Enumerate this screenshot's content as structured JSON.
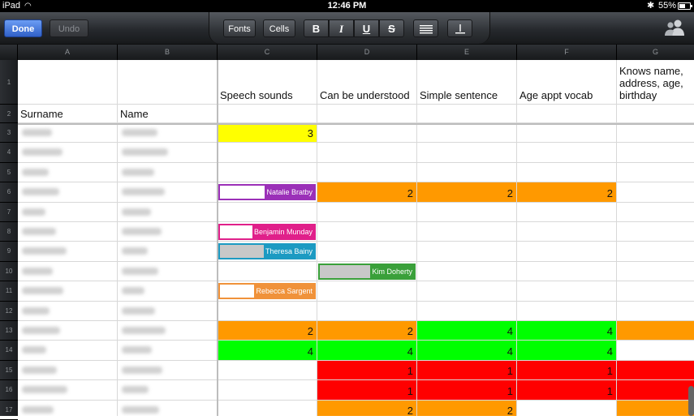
{
  "status_bar": {
    "device": "iPad",
    "time": "12:46 PM",
    "battery": "55%"
  },
  "toolbar": {
    "done_label": "Done",
    "undo_label": "Undo",
    "fonts_label": "Fonts",
    "cells_label": "Cells",
    "bold_label": "B",
    "italic_label": "I",
    "underline_label": "U",
    "strike_label": "S"
  },
  "columns": [
    "A",
    "B",
    "C",
    "D",
    "E",
    "F",
    "G"
  ],
  "rows": [
    "1",
    "2",
    "3",
    "4",
    "5",
    "6",
    "7",
    "8",
    "9",
    "10",
    "11",
    "12",
    "13",
    "14",
    "15",
    "16",
    "17"
  ],
  "headers": {
    "surname": "Surname",
    "name": "Name",
    "c": "Speech sounds",
    "d": "Can be understood",
    "e": "Simple sentence",
    "f": "Age appt vocab",
    "g": "Knows name, address, age, birthday"
  },
  "colors": {
    "yellow": "#ffff00",
    "orange": "#ff9900",
    "green": "#00ff00",
    "red": "#ff0000",
    "accent_blue": "#3060c8"
  },
  "comments": [
    {
      "row": 6,
      "col": "C",
      "author": "Natalie Bratby",
      "color": "#9b30b8"
    },
    {
      "row": 8,
      "col": "C",
      "author": "Benjamin Munday",
      "color": "#e0208a"
    },
    {
      "row": 9,
      "col": "C",
      "author": "Theresa Bainy",
      "color": "#1c9ac2"
    },
    {
      "row": 10,
      "col": "D",
      "author": "Kim Doherty",
      "color": "#3aa03a"
    },
    {
      "row": 11,
      "col": "C",
      "author": "Rebecca Sargent",
      "color": "#f0923a"
    }
  ],
  "cells": [
    {
      "row": 3,
      "col": "C",
      "value": "3",
      "fill": "#ffff00"
    },
    {
      "row": 6,
      "col": "D",
      "value": "2",
      "fill": "#ff9900"
    },
    {
      "row": 6,
      "col": "E",
      "value": "2",
      "fill": "#ff9900"
    },
    {
      "row": 6,
      "col": "F",
      "value": "2",
      "fill": "#ff9900"
    },
    {
      "row": 13,
      "col": "C",
      "value": "2",
      "fill": "#ff9900"
    },
    {
      "row": 13,
      "col": "D",
      "value": "2",
      "fill": "#ff9900"
    },
    {
      "row": 13,
      "col": "E",
      "value": "4",
      "fill": "#00ff00"
    },
    {
      "row": 13,
      "col": "F",
      "value": "4",
      "fill": "#00ff00"
    },
    {
      "row": 13,
      "col": "G",
      "value": "",
      "fill": "#ff9900"
    },
    {
      "row": 14,
      "col": "C",
      "value": "4",
      "fill": "#00ff00"
    },
    {
      "row": 14,
      "col": "D",
      "value": "4",
      "fill": "#00ff00"
    },
    {
      "row": 14,
      "col": "E",
      "value": "4",
      "fill": "#00ff00"
    },
    {
      "row": 14,
      "col": "F",
      "value": "4",
      "fill": "#00ff00"
    },
    {
      "row": 15,
      "col": "D",
      "value": "1",
      "fill": "#ff0000"
    },
    {
      "row": 15,
      "col": "E",
      "value": "1",
      "fill": "#ff0000"
    },
    {
      "row": 15,
      "col": "F",
      "value": "1",
      "fill": "#ff0000"
    },
    {
      "row": 15,
      "col": "G",
      "value": "",
      "fill": "#ff0000"
    },
    {
      "row": 16,
      "col": "D",
      "value": "1",
      "fill": "#ff0000"
    },
    {
      "row": 16,
      "col": "E",
      "value": "1",
      "fill": "#ff0000"
    },
    {
      "row": 16,
      "col": "F",
      "value": "1",
      "fill": "#ff0000"
    },
    {
      "row": 16,
      "col": "G",
      "value": "",
      "fill": "#ff0000"
    },
    {
      "row": 17,
      "col": "D",
      "value": "2",
      "fill": "#ff9900"
    },
    {
      "row": 17,
      "col": "E",
      "value": "2",
      "fill": "#ff9900"
    },
    {
      "row": 17,
      "col": "G",
      "value": "",
      "fill": "#ff9900"
    }
  ]
}
